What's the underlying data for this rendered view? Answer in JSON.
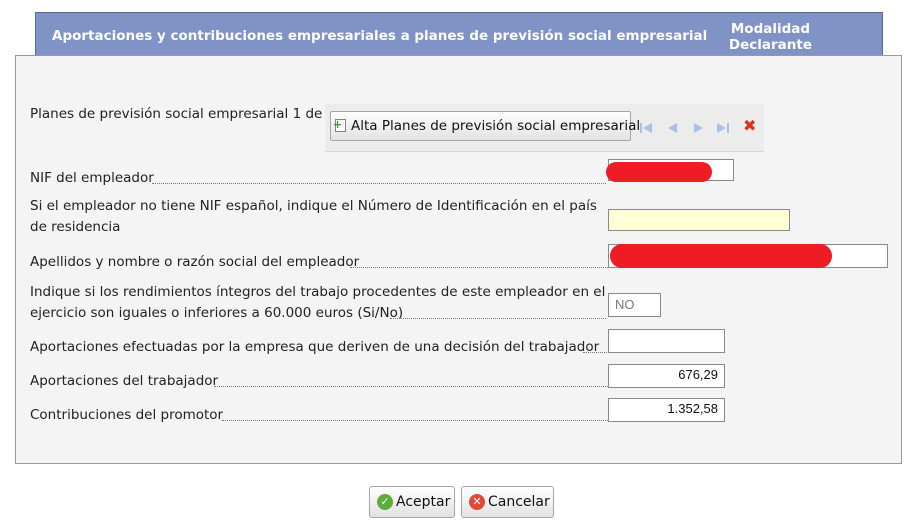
{
  "header": {
    "title": "Aportaciones y contribuciones empresariales a planes de previsión social empresarial",
    "modalidad_line1": "Modalidad",
    "modalidad_line2": "Declarante"
  },
  "planes": {
    "label": "Planes de previsión social empresarial 1 de 1",
    "alta_button": "Alta Planes de previsión social empresarial"
  },
  "fields": {
    "nif_label": "NIF del empleador",
    "nif_value": "",
    "nif_ext_label_line1": "Si el empleador no tiene NIF español, indique el Número de Identificación en el país",
    "nif_ext_label_line2": "de residencia",
    "nif_ext_value": "",
    "nombre_label": "Apellidos y nombre o razón social del empleador",
    "nombre_value": "",
    "rend_label_line1": "Indique si los rendimientos íntegros del trabajo procedentes de este empleador en el",
    "rend_label_line2": "ejercicio son iguales o inferiores a 60.000 euros (Si/No)",
    "rend_value": "NO",
    "aport_empresa_label": "Aportaciones efectuadas por la empresa que deriven de una decisión del trabajador",
    "aport_empresa_value": "",
    "aport_trab_label": "Aportaciones del trabajador",
    "aport_trab_value": "676,29",
    "contrib_label": "Contribuciones del promotor",
    "contrib_value": "1.352,58"
  },
  "buttons": {
    "accept": "Aceptar",
    "cancel": "Cancelar"
  },
  "colors": {
    "header_bg": "#7f93c7",
    "redaction": "#ef1c25",
    "highlight_field": "#ffffd6"
  }
}
